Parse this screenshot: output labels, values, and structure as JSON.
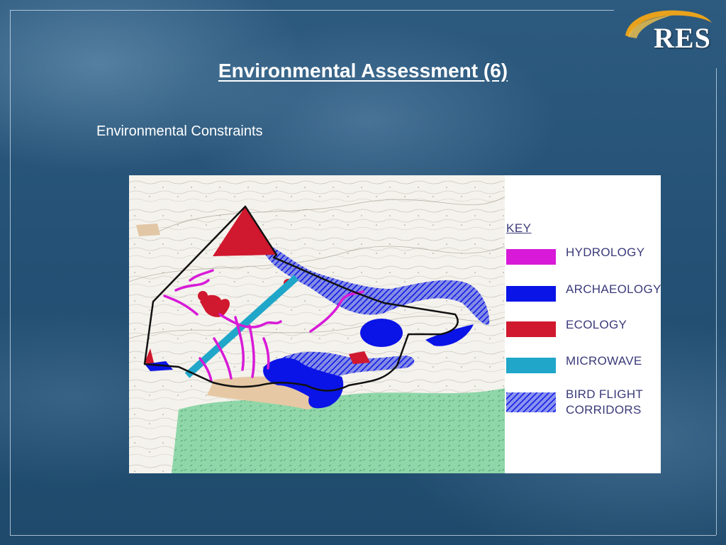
{
  "logo": {
    "text": "RES"
  },
  "slide": {
    "title": "Environmental Assessment (6)",
    "subtitle": "Environmental Constraints"
  },
  "map": {
    "key_title": "KEY",
    "key": [
      {
        "label": "HYDROLOGY",
        "color": "#d81ad8",
        "pattern": "solid"
      },
      {
        "label": "ARCHAEOLOGY",
        "color": "#0a14e6",
        "pattern": "solid"
      },
      {
        "label": "ECOLOGY",
        "color": "#d0182e",
        "pattern": "solid"
      },
      {
        "label": "MICROWAVE",
        "color": "#1fa6c9",
        "pattern": "solid"
      },
      {
        "label": "BIRD FLIGHT CORRIDORS",
        "color": "#2a3ae0",
        "pattern": "hatched"
      }
    ]
  },
  "colors": {
    "background": "#245175",
    "map_base": "#f4f2ec",
    "forest": "#8fd6a8",
    "sand": "#e6c9a4"
  }
}
